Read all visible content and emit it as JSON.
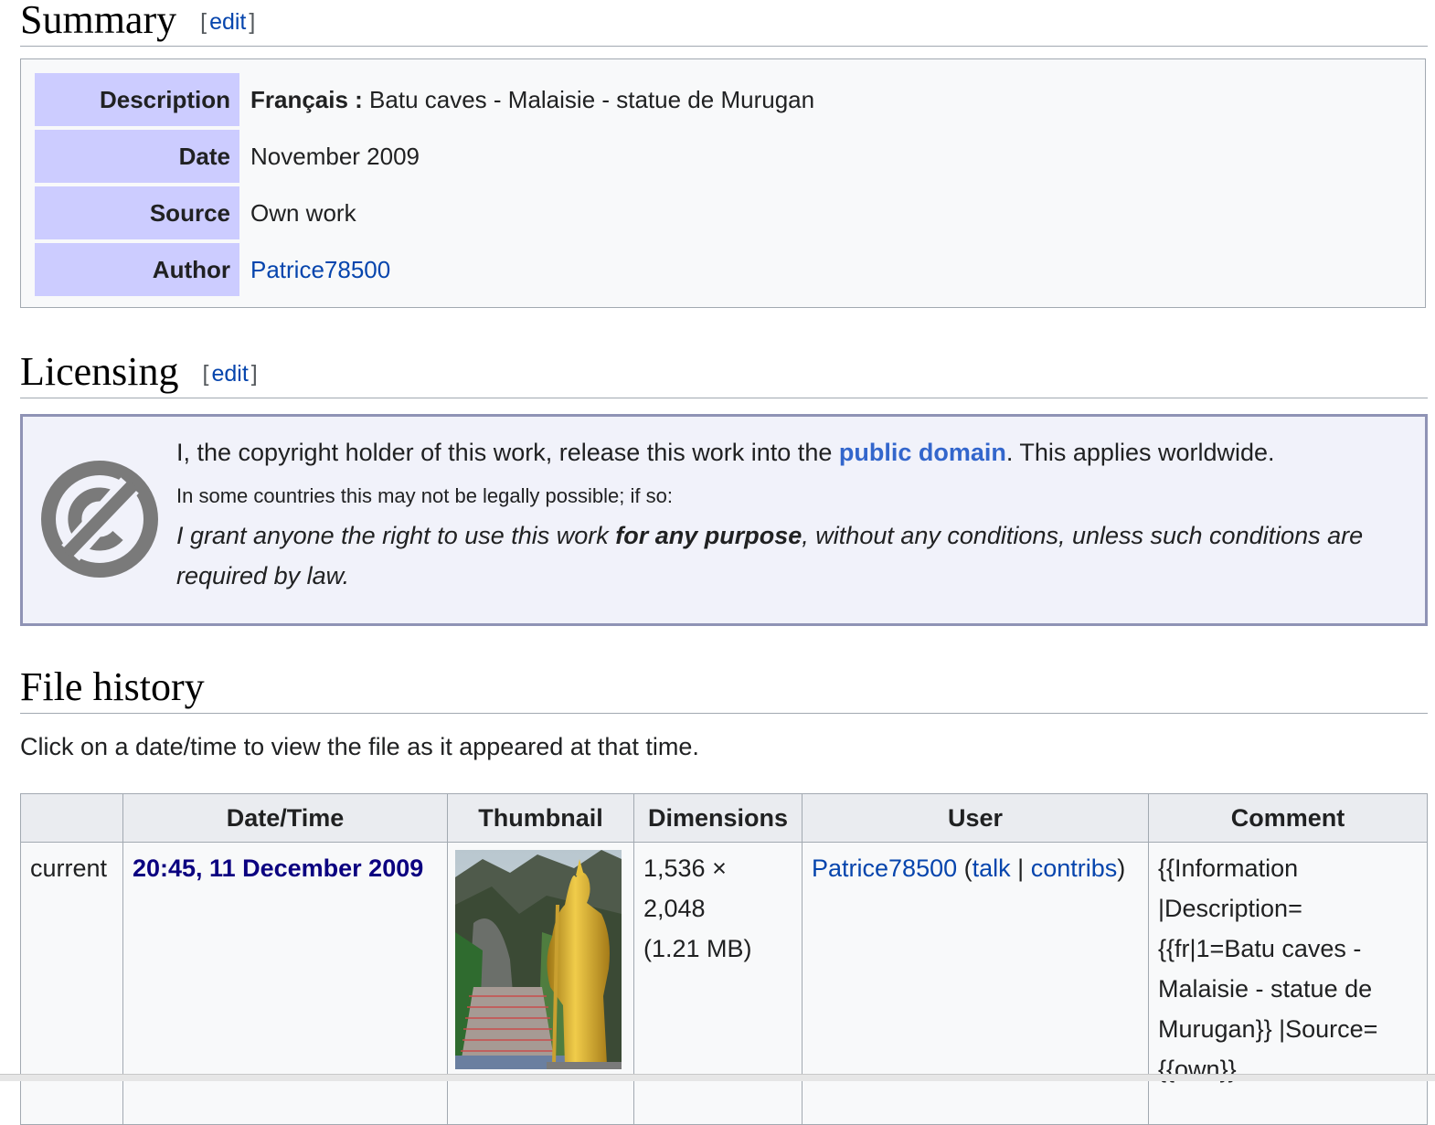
{
  "summary": {
    "heading": "Summary",
    "edit_bracket_open": "[",
    "edit_link": "edit",
    "edit_bracket_close": "]",
    "rows": [
      {
        "label": "Description",
        "lang": "Français :",
        "value": " Batu caves - Malaisie - statue de Murugan"
      },
      {
        "label": "Date",
        "value": "November 2009"
      },
      {
        "label": "Source",
        "value": "Own work"
      },
      {
        "label": "Author",
        "value": "Patrice78500"
      }
    ]
  },
  "licensing": {
    "heading": "Licensing",
    "edit_bracket_open": "[",
    "edit_link": "edit",
    "edit_bracket_close": "]",
    "line1_before": "I, the copyright holder of this work, release this work into the ",
    "line1_link": "public domain",
    "line1_after": ". This applies worldwide.",
    "line2": "In some countries this may not be legally possible; if so:",
    "grant_before": "I grant anyone the right to use this work ",
    "grant_bold": "for any purpose",
    "grant_after": ", without any conditions, unless such conditions are required by law.",
    "icon": "public-domain-icon"
  },
  "file_history": {
    "heading": "File history",
    "caption": "Click on a date/time to view the file as it appeared at that time.",
    "columns": [
      "",
      "Date/Time",
      "Thumbnail",
      "Dimensions",
      "User",
      "Comment"
    ],
    "rows": [
      {
        "status": "current",
        "datetime": "20:45, 11 December 2009",
        "dimensions_line1": "1,536 ×",
        "dimensions_line2": "2,048",
        "dimensions_line3": "(1.21 MB)",
        "user": "Patrice78500",
        "user_open_paren": " (",
        "talk": "talk",
        "sep": " | ",
        "contribs": "contribs",
        "user_close_paren": ")",
        "comment": "{{Information |Description= {{fr|1=Batu caves - Malaisie - statue de Murugan}} |Source= {{own}}"
      }
    ]
  }
}
